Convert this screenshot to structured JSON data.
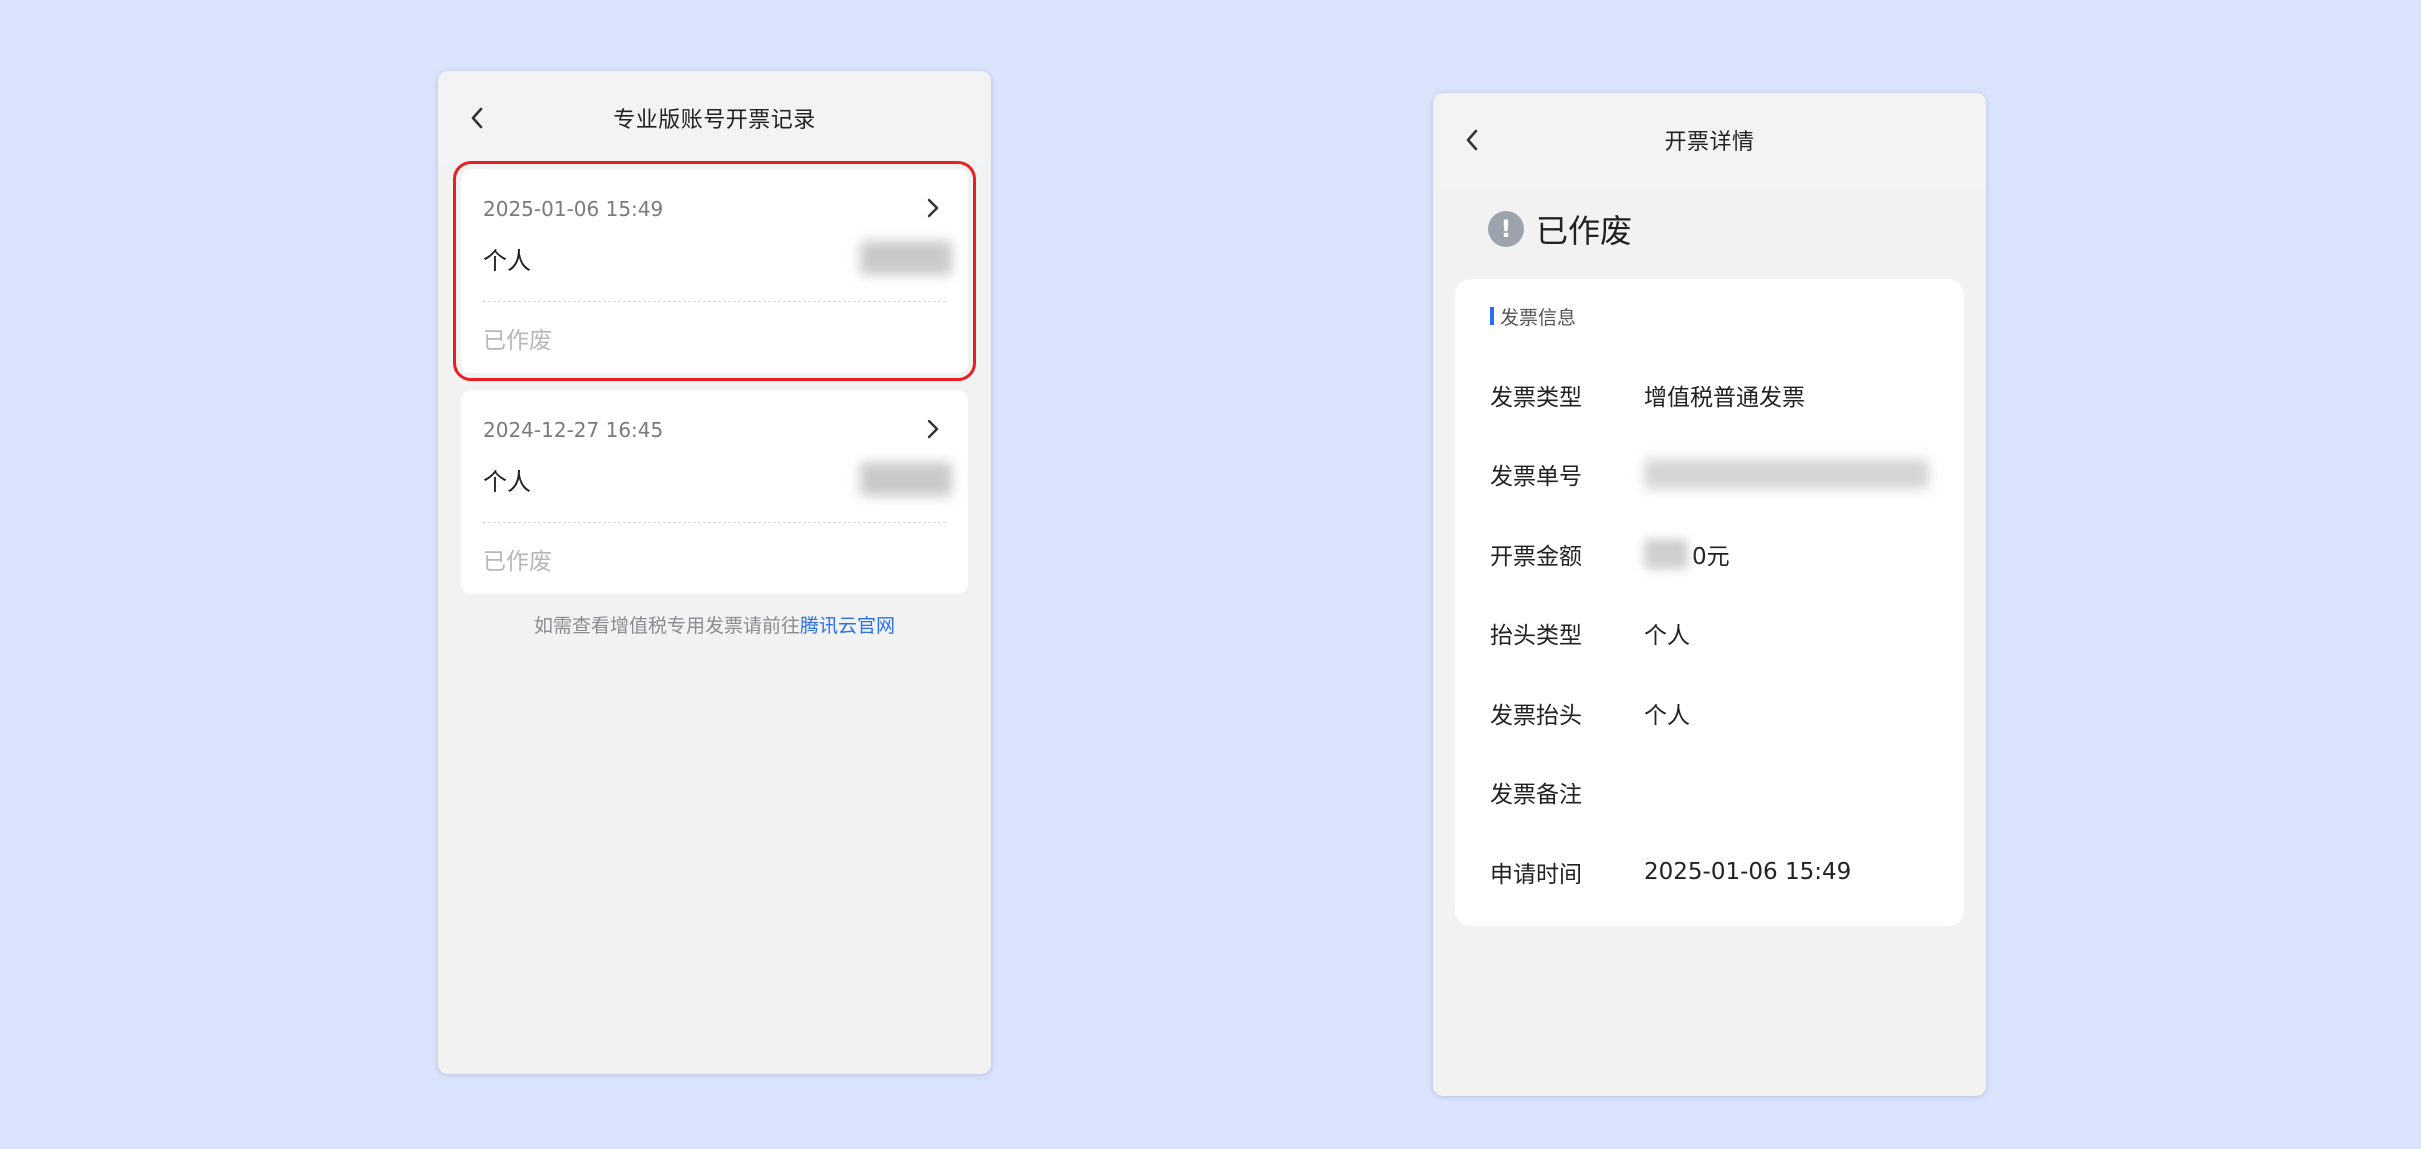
{
  "left_screen": {
    "title": "专业版账号开票记录",
    "records": [
      {
        "date": "2025-01-06 15:49",
        "name": "个人",
        "status": "已作废"
      },
      {
        "date": "2024-12-27 16:45",
        "name": "个人",
        "status": "已作废"
      }
    ],
    "footer_prefix": "如需查看增值税专用发票请前往",
    "footer_link": "腾讯云官网"
  },
  "right_screen": {
    "title": "开票详情",
    "state": "已作废",
    "state_icon": "exclamation-icon",
    "section_title": "发票信息",
    "rows": {
      "type_label": "发票类型",
      "type_value": "增值税普通发票",
      "number_label": "发票单号",
      "amount_label": "开票金额",
      "amount_suffix": "0元",
      "title_type_label": "抬头类型",
      "title_type_value": "个人",
      "invoice_title_label": "发票抬头",
      "invoice_title_value": "个人",
      "remark_label": "发票备注",
      "remark_value": "",
      "time_label": "申请时间",
      "time_value": "2025-01-06 15:49"
    }
  },
  "colors": {
    "background": "#dbe4fd",
    "accent": "#2a6ff0",
    "highlight": "#e8201f"
  }
}
